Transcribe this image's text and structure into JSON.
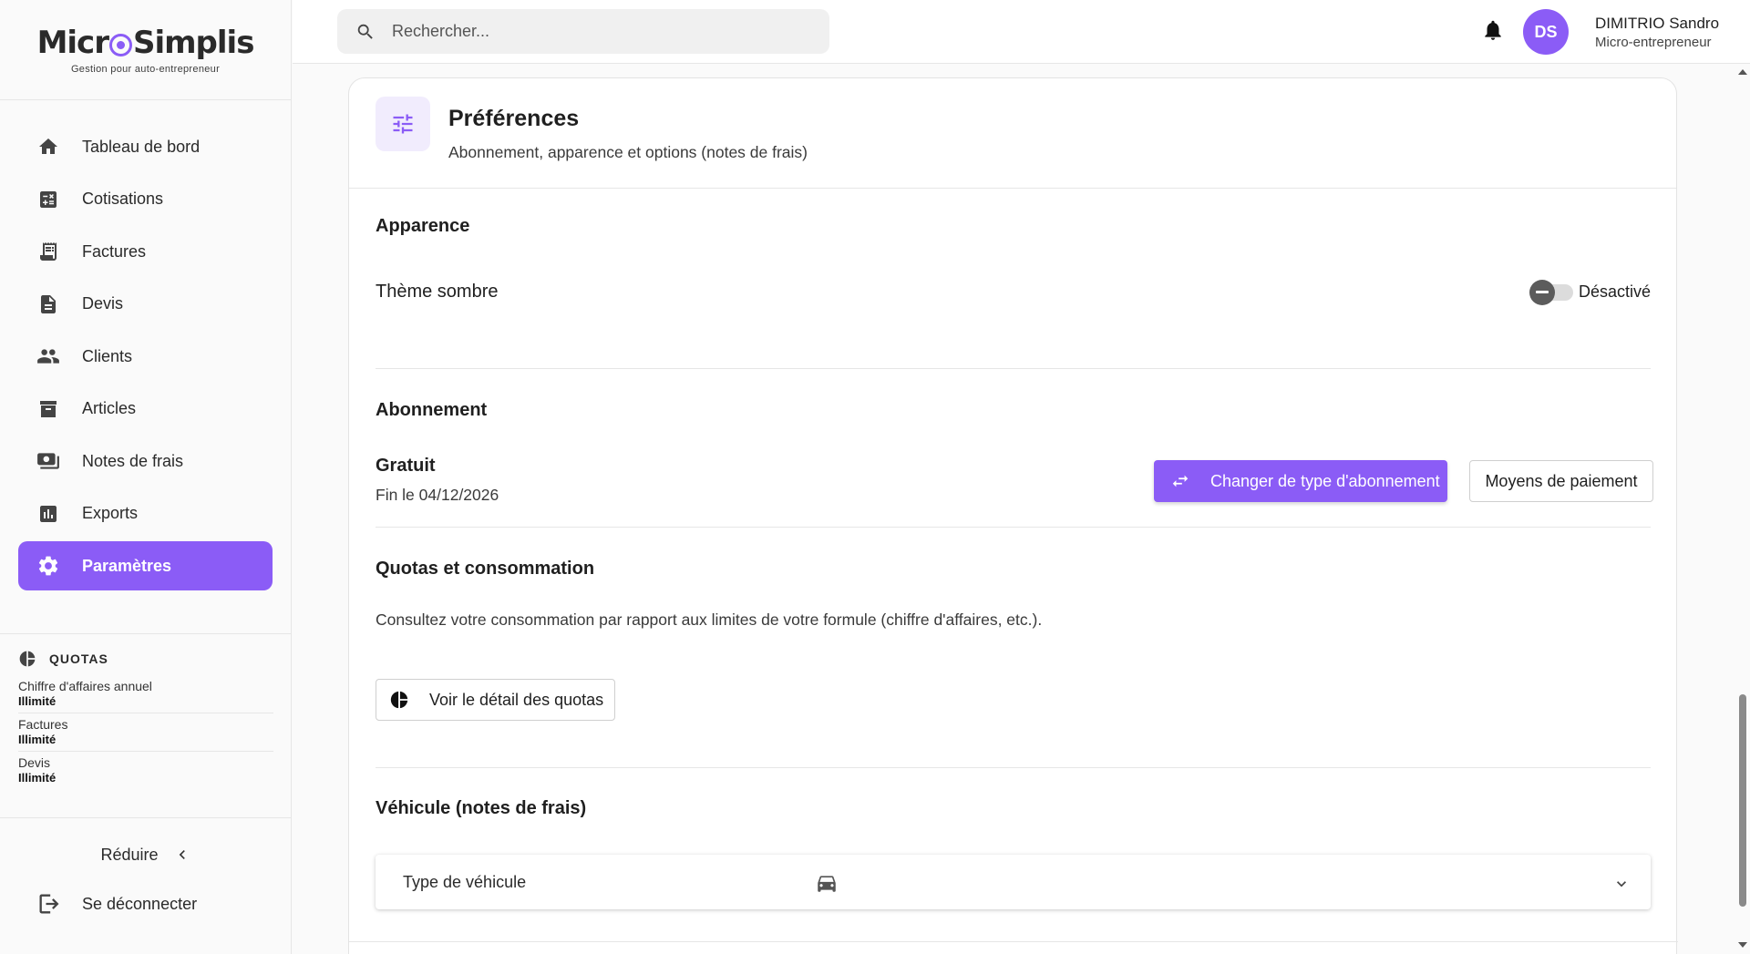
{
  "brand": {
    "name_left": "Micr",
    "name_right": "Simplis",
    "tagline": "Gestion pour auto-entrepreneur",
    "accent": "#8b5cf6"
  },
  "sidebar": {
    "items": [
      {
        "label": "Tableau de bord",
        "icon": "home-icon"
      },
      {
        "label": "Cotisations",
        "icon": "calculator-icon"
      },
      {
        "label": "Factures",
        "icon": "receipt-icon"
      },
      {
        "label": "Devis",
        "icon": "document-icon"
      },
      {
        "label": "Clients",
        "icon": "people-icon"
      },
      {
        "label": "Articles",
        "icon": "archive-icon"
      },
      {
        "label": "Notes de frais",
        "icon": "money-icon"
      },
      {
        "label": "Exports",
        "icon": "bar-chart-icon"
      },
      {
        "label": "Paramètres",
        "icon": "gear-icon",
        "active": true
      }
    ],
    "quotas": {
      "title": "QUOTAS",
      "items": [
        {
          "label": "Chiffre d'affaires annuel",
          "value": "Illimité"
        },
        {
          "label": "Factures",
          "value": "Illimité"
        },
        {
          "label": "Devis",
          "value": "Illimité"
        }
      ]
    },
    "reduce_label": "Réduire",
    "logout_label": "Se déconnecter"
  },
  "topbar": {
    "search_placeholder": "Rechercher...",
    "avatar_initials": "DS",
    "user_name": "DIMITRIO Sandro",
    "user_role": "Micro-entrepreneur"
  },
  "page": {
    "title": "Préférences",
    "subtitle": "Abonnement, apparence et options (notes de frais)",
    "appearance": {
      "title": "Apparence",
      "dark_theme_label": "Thème sombre",
      "dark_theme_state": "Désactivé"
    },
    "subscription": {
      "title": "Abonnement",
      "plan": "Gratuit",
      "end_date": "Fin le 04/12/2026",
      "change_button": "Changer de type d'abonnement",
      "payment_button": "Moyens de paiement"
    },
    "quotas": {
      "title": "Quotas et consommation",
      "description": "Consultez votre consommation par rapport aux limites de votre formule (chiffre d'affaires, etc.).",
      "detail_button": "Voir le détail des quotas"
    },
    "vehicle": {
      "title": "Véhicule (notes de frais)",
      "select_label": "Type de véhicule"
    }
  }
}
